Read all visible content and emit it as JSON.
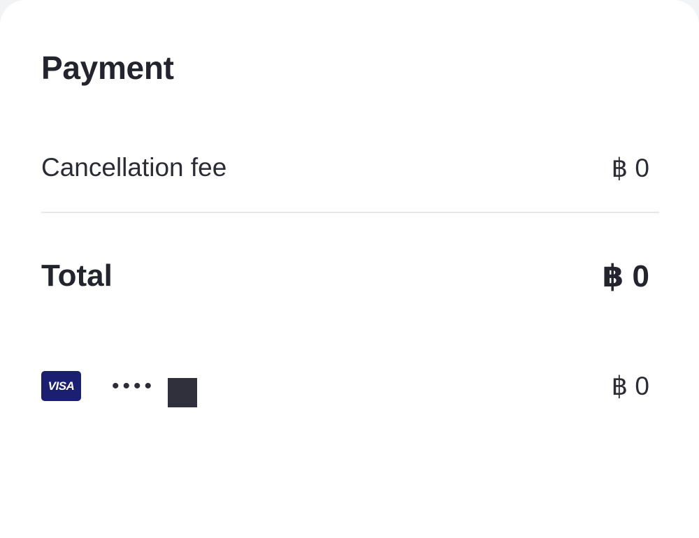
{
  "payment": {
    "title": "Payment",
    "fee_label": "Cancellation fee",
    "fee_value": "฿ 0",
    "total_label": "Total",
    "total_value": "฿ 0",
    "card": {
      "brand": "VISA",
      "brand_color": "#1a1f71",
      "masked_number": "••••",
      "amount": "฿ 0"
    }
  }
}
